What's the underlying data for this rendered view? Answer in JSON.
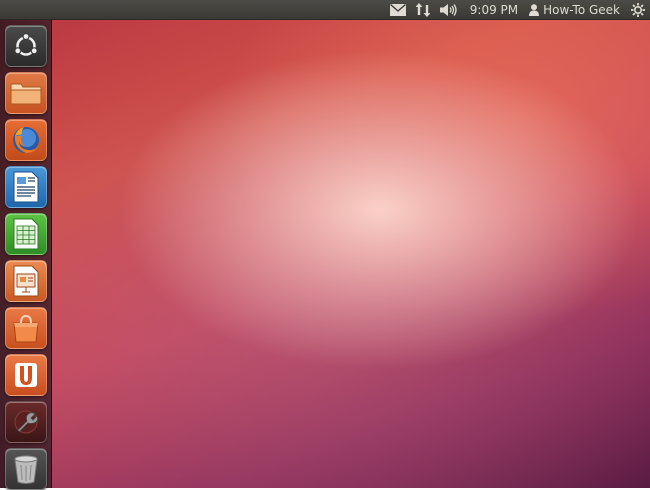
{
  "top_panel": {
    "clock": "9:09 PM",
    "user_name": "How-To Geek",
    "indicators": [
      "mail-icon",
      "network-icon",
      "volume-icon",
      "user-icon",
      "session-gear-icon"
    ]
  },
  "launcher": {
    "items": [
      {
        "name": "dash-home",
        "icon": "ubuntu-logo-icon"
      },
      {
        "name": "home-folder",
        "icon": "folder-icon"
      },
      {
        "name": "firefox",
        "icon": "firefox-icon"
      },
      {
        "name": "libreoffice-writer",
        "icon": "writer-document-icon"
      },
      {
        "name": "libreoffice-calc",
        "icon": "calc-spreadsheet-icon"
      },
      {
        "name": "libreoffice-impress",
        "icon": "impress-presentation-icon"
      },
      {
        "name": "ubuntu-software-center",
        "icon": "shopping-bag-icon"
      },
      {
        "name": "ubuntu-one",
        "icon": "ubuntu-one-icon"
      },
      {
        "name": "system-settings",
        "icon": "settings-wrench-icon"
      },
      {
        "name": "trash",
        "icon": "trash-icon"
      }
    ]
  },
  "colors": {
    "panel": "#3c3b37",
    "panel_text": "#dfdbd2",
    "wallpaper_accent": "#d2534b",
    "launcher_bg": "#2d1a22"
  }
}
